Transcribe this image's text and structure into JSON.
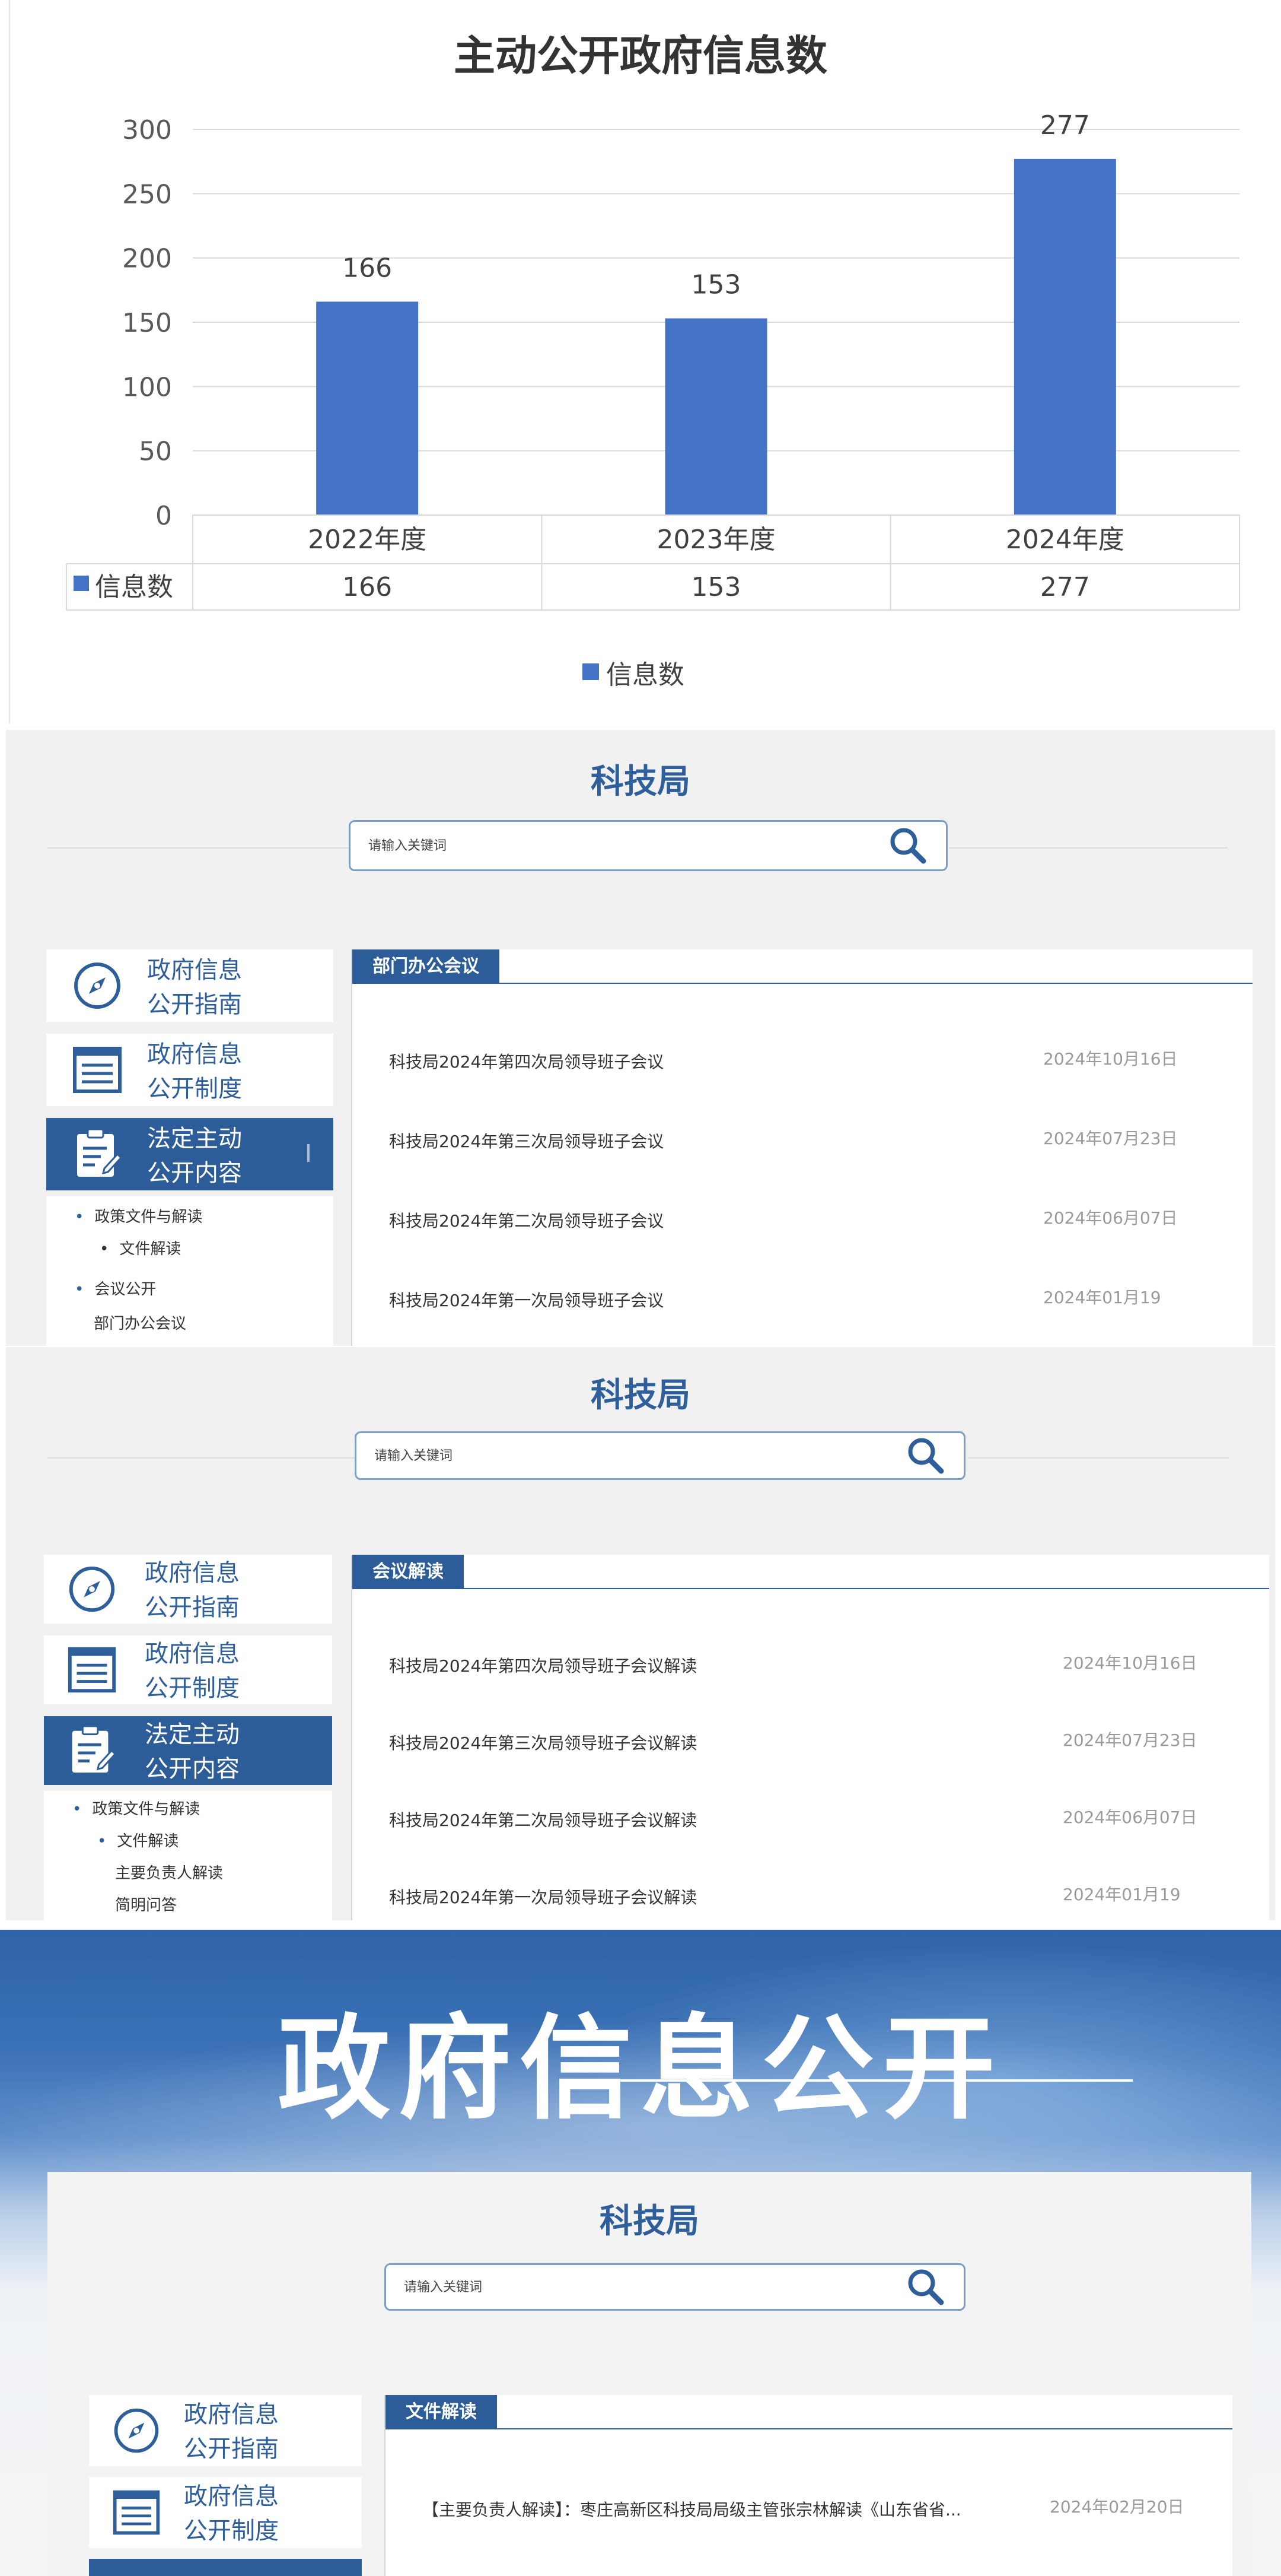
{
  "chart_data": {
    "type": "bar",
    "title": "主动公开政府信息数",
    "categories": [
      "2022年度",
      "2023年度",
      "2024年度"
    ],
    "series": [
      {
        "name": "信息数",
        "values": [
          166,
          153,
          277
        ],
        "color": "#4472c4"
      }
    ],
    "ylim": [
      0,
      300
    ],
    "yticks": [
      0,
      50,
      100,
      150,
      200,
      250,
      300
    ],
    "data_labels": [
      "166",
      "153",
      "277"
    ],
    "data_table": {
      "row_label": "信息数",
      "values": [
        "166",
        "153",
        "277"
      ]
    },
    "legend": {
      "label": "信息数",
      "placement": "bottom"
    },
    "grid": true
  },
  "panel1": {
    "site_title": "科技局",
    "search": {
      "placeholder": "请输入关键词"
    },
    "sidebar": [
      {
        "line1": "政府信息",
        "line2": "公开指南",
        "icon": "compass-icon"
      },
      {
        "line1": "政府信息",
        "line2": "公开制度",
        "icon": "list-icon"
      },
      {
        "line1": "法定主动",
        "line2": "公开内容",
        "icon": "clipboard-edit-icon"
      }
    ],
    "submenu": [
      "政策文件与解读",
      "文件解读",
      "会议公开",
      "部门办公会议"
    ],
    "tab": "部门办公会议",
    "rows": [
      {
        "title": "科技局2024年第四次局领导班子会议",
        "date": "2024年10月16日"
      },
      {
        "title": "科技局2024年第三次局领导班子会议",
        "date": "2024年07月23日"
      },
      {
        "title": "科技局2024年第二次局领导班子会议",
        "date": "2024年06月07日"
      },
      {
        "title": "科技局2024年第一次局领导班子会议",
        "date": "2024年01月19"
      }
    ]
  },
  "panel2": {
    "site_title": "科技局",
    "search": {
      "placeholder": "请输入关键词"
    },
    "sidebar": [
      {
        "line1": "政府信息",
        "line2": "公开指南",
        "icon": "compass-icon"
      },
      {
        "line1": "政府信息",
        "line2": "公开制度",
        "icon": "list-icon"
      },
      {
        "line1": "法定主动",
        "line2": "公开内容",
        "icon": "clipboard-edit-icon"
      }
    ],
    "submenu": [
      "政策文件与解读",
      "文件解读",
      "主要负责人解读",
      "简明问答"
    ],
    "tab": "会议解读",
    "rows": [
      {
        "title": "科技局2024年第四次局领导班子会议解读",
        "date": "2024年10月16日"
      },
      {
        "title": "科技局2024年第三次局领导班子会议解读",
        "date": "2024年07月23日"
      },
      {
        "title": "科技局2024年第二次局领导班子会议解读",
        "date": "2024年06月07日"
      },
      {
        "title": "科技局2024年第一次局领导班子会议解读",
        "date": "2024年01月19"
      }
    ]
  },
  "banner": {
    "title": "政府信息公开"
  },
  "panel3": {
    "site_title": "科技局",
    "search": {
      "placeholder": "请输入关键词"
    },
    "sidebar": [
      {
        "line1": "政府信息",
        "line2": "公开指南",
        "icon": "compass-icon"
      },
      {
        "line1": "政府信息",
        "line2": "公开制度",
        "icon": "list-icon"
      }
    ],
    "tab": "文件解读",
    "rows": [
      {
        "title": "【主要负责人解读】：枣庄高新区科技局局级主管张宗林解读《山东省省...",
        "date": "2024年02月20日"
      }
    ]
  }
}
